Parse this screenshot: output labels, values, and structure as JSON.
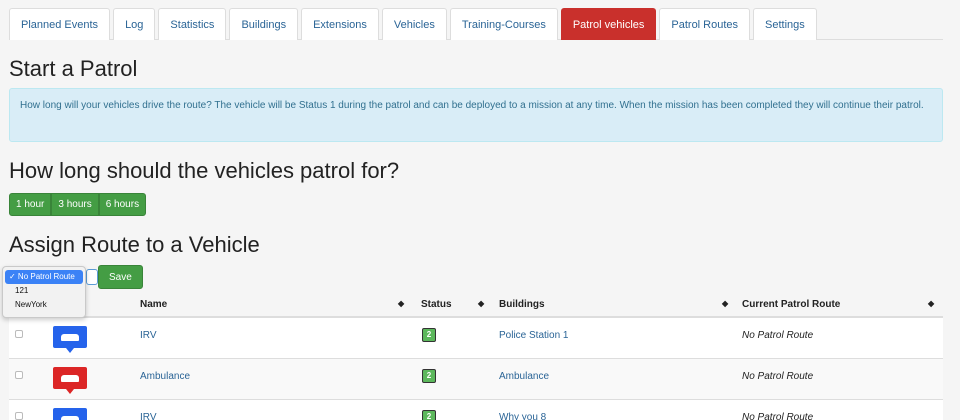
{
  "tabs": [
    {
      "label": "Planned Events",
      "active": false
    },
    {
      "label": "Log",
      "active": false
    },
    {
      "label": "Statistics",
      "active": false
    },
    {
      "label": "Buildings",
      "active": false
    },
    {
      "label": "Extensions",
      "active": false
    },
    {
      "label": "Vehicles",
      "active": false
    },
    {
      "label": "Training-Courses",
      "active": false
    },
    {
      "label": "Patrol vehicles",
      "active": true
    },
    {
      "label": "Patrol Routes",
      "active": false
    },
    {
      "label": "Settings",
      "active": false
    }
  ],
  "start_title": "Start a Patrol",
  "info_text": "How long will your vehicles drive the route? The vehicle will be Status 1 during the patrol and can be deployed to a mission at any time. When the mission has been completed they will continue their patrol.",
  "duration_title": "How long should the vehicles patrol for?",
  "durations": [
    "1 hour",
    "3 hours",
    "6 hours"
  ],
  "assign_title": "Assign Route to a Vehicle",
  "route_select": {
    "options": [
      "✓ No Patrol Route",
      "121",
      "NewYork"
    ]
  },
  "save_label": "Save",
  "table": {
    "headers": {
      "name": "Name",
      "status": "Status",
      "buildings": "Buildings",
      "route": "Current Patrol Route"
    },
    "sort_icon": "◆",
    "rows": [
      {
        "icon": "police-car-icon",
        "color": "#2563eb",
        "name": "IRV",
        "status": "2",
        "building": "Police Station 1",
        "route": "No Patrol Route"
      },
      {
        "icon": "ambulance-icon",
        "color": "#dc2626",
        "name": "Ambulance",
        "status": "2",
        "building": "Ambulance",
        "route": "No Patrol Route"
      },
      {
        "icon": "police-car-icon",
        "color": "#2563eb",
        "name": "IRV",
        "status": "2",
        "building": "Why you 8",
        "route": "No Patrol Route"
      }
    ]
  },
  "colors": {
    "active_tab": "#c9302c",
    "button_green": "#449d44",
    "status_green": "#5cb85c",
    "info_bg": "#d9edf7"
  }
}
